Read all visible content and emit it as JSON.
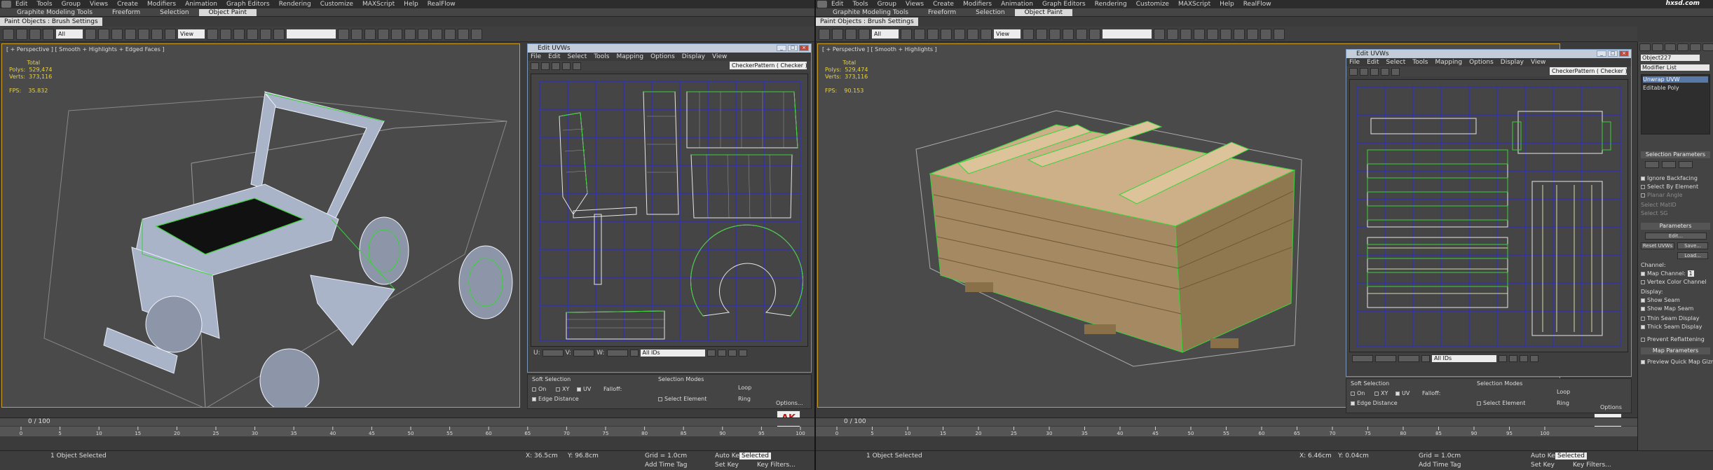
{
  "left_window": {
    "menu": [
      "Edit",
      "Tools",
      "Group",
      "Views",
      "Create",
      "Modifiers",
      "Animation",
      "Graph Editors",
      "Rendering",
      "Customize",
      "MAXScript",
      "Help",
      "RealFlow"
    ],
    "ribbon_tabs": [
      "Graphite Modeling Tools",
      "Freeform",
      "Selection",
      "Object Paint"
    ],
    "active_tab": "Object Paint",
    "subribbon": "Paint Objects : Brush Settings",
    "toolbar_selection_filter": "All",
    "toolbar_view_dropdown": "View",
    "viewport_label": "[ + Perspective ] [ Smooth + Highlights + Edged Faces ]",
    "stats": "          Total\nPolys:  529,474\nVerts:  373,116\n\nFPS:    35.832",
    "timeslider": "0 / 100",
    "ruler_ticks": [
      "0",
      "5",
      "10",
      "15",
      "20",
      "25",
      "30",
      "35",
      "40",
      "45",
      "50",
      "55",
      "60",
      "65",
      "70",
      "75",
      "80",
      "85",
      "90",
      "95",
      "100"
    ],
    "status_selected": "1 Object Selected",
    "coord_x": "X: 36.5cm",
    "coord_y": "Y: 96.8cm",
    "grid": "Grid = 1.0cm",
    "auto_key": "Auto Key",
    "set_key": "Set Key",
    "key_mode": "Selected",
    "key_filters": "Key Filters...",
    "add_time_tag": "Add Time Tag",
    "uv_editor": {
      "title": "Edit UVWs",
      "menu": [
        "File",
        "Edit",
        "Select",
        "Tools",
        "Mapping",
        "Options",
        "Display",
        "View"
      ],
      "checker": "CheckerPattern ( Checker )",
      "u": "U:",
      "v": "V:",
      "w": "W:",
      "ids": "All IDs",
      "soft_selection": "Soft Selection",
      "on": "On",
      "xy": "XY",
      "uv": "UV",
      "falloff": "Falloff:",
      "edge_distance": "Edge Distance",
      "selection_modes": "Selection Modes",
      "select_element": "Select Element",
      "loop": "Loop",
      "ring": "Ring",
      "options": "Options..."
    },
    "logo": "AK"
  },
  "right_window": {
    "menu": [
      "Edit",
      "Tools",
      "Group",
      "Views",
      "Create",
      "Modifiers",
      "Animation",
      "Graph Editors",
      "Rendering",
      "Customize",
      "MAXScript",
      "Help",
      "RealFlow"
    ],
    "ribbon_tabs": [
      "Graphite Modeling Tools",
      "Freeform",
      "Selection",
      "Object Paint"
    ],
    "active_tab": "Object Paint",
    "subribbon": "Paint Objects : Brush Settings",
    "toolbar_selection_filter": "All",
    "toolbar_view_dropdown": "View",
    "viewport_label": "[ + Perspective ] [ Smooth + Highlights ]",
    "stats": "          Total\nPolys:  529,474\nVerts:  373,116\n\nFPS:    90.153",
    "timeslider": "0 / 100",
    "status_selected": "1 Object Selected",
    "coord_x": "X: 6.46cm",
    "coord_y": "Y: 0.04cm",
    "grid": "Grid = 1.0cm",
    "auto_key": "Auto Key",
    "set_key": "Set Key",
    "key_mode": "Selected",
    "key_filters": "Key Filters...",
    "add_time_tag": "Add Time Tag",
    "watermark": "hxsd.com",
    "uv_editor": {
      "title": "Edit UVWs",
      "menu": [
        "File",
        "Edit",
        "Select",
        "Tools",
        "Mapping",
        "Options",
        "Display",
        "View"
      ],
      "checker": "CheckerPattern ( Checker )",
      "ids": "All IDs",
      "soft_selection": "Soft Selection",
      "on": "On",
      "xy": "XY",
      "uv": "UV",
      "falloff": "Falloff:",
      "edge_distance": "Edge Distance",
      "selection_modes": "Selection Modes",
      "select_element": "Select Element",
      "loop": "Loop",
      "ring": "Ring",
      "options": "Options"
    },
    "command_panel": {
      "object_name": "Object227",
      "modifier_list": "Modifier List",
      "stack": [
        "Unwrap UVW",
        "Editable Poly"
      ],
      "selection_parameters": "Selection Parameters",
      "ignore_backfacing": "Ignore Backfacing",
      "select_by_element": "Select By Element",
      "planar_angle": "Planar Angle",
      "select_mat_id": "Select MatID",
      "select_sg": "Select SG",
      "parameters": "Parameters",
      "edit": "Edit...",
      "reset_uvws": "Reset UVWs",
      "save": "Save...",
      "load": "Load...",
      "channel": "Channel:",
      "map_channel": "Map Channel:",
      "map_channel_value": "1",
      "vertex_color_channel": "Vertex Color Channel",
      "display": "Display:",
      "show_seam": "Show Seam",
      "show_map_seam": "Show Map Seam",
      "thin_seam": "Thin Seam Display",
      "thick_seam": "Thick Seam Display",
      "prevent_reflattening": "Prevent Reflattening",
      "map_parameters": "Map Parameters",
      "preview_quick_map": "Preview Quick Map Gizmo"
    }
  }
}
